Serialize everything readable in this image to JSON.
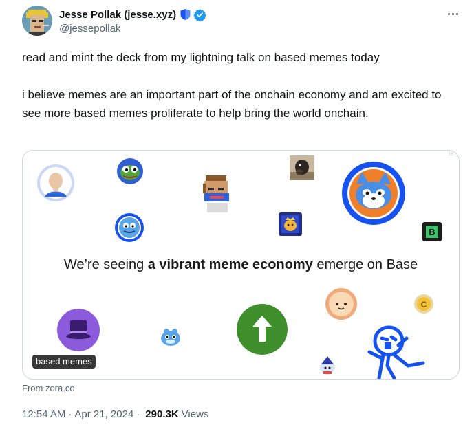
{
  "author": {
    "display_name": "Jesse Pollak (jesse.xyz)",
    "handle": "@jessepollak",
    "badges": [
      "shield-icon",
      "verified-icon"
    ]
  },
  "tweet": {
    "paragraphs": [
      "read and mint the deck from my lightning talk on based memes today",
      "i believe memes are an important part of the onchain economy and am excited to see more based memes proliferate to help bring the world onchain."
    ]
  },
  "card": {
    "headline_pre": "We’re seeing ",
    "headline_bold": "a vibrant meme economy",
    "headline_post": " emerge on Base",
    "label": "based memes",
    "source": "From zora.co",
    "corner_mark": "19"
  },
  "meta": {
    "time": "12:54 AM",
    "separator": "·",
    "date": "Apr 21, 2024",
    "views_count": "290.3K",
    "views_label": "Views"
  },
  "colors": {
    "base_blue": "#1652f0",
    "up_green": "#3f8f2c",
    "verified": "#1d9bf0",
    "muted_text": "#536471"
  }
}
